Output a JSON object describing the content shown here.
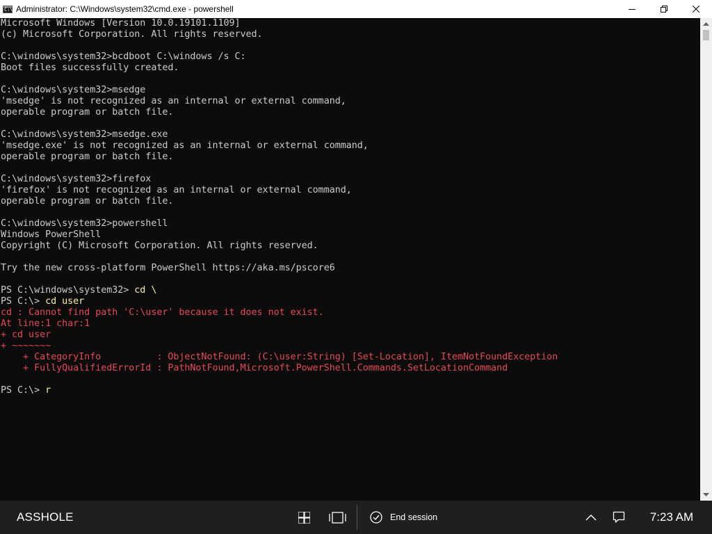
{
  "window": {
    "title": "Administrator: C:\\Windows\\system32\\cmd.exe - powershell",
    "icon": "cmd-icon",
    "icon_glyph": "C:\\",
    "controls": [
      "minimize-icon",
      "restore-icon",
      "close-icon"
    ]
  },
  "console": {
    "background": "#0c0c0c",
    "colors": {
      "default": "#cccccc",
      "error": "#e74856",
      "input": "#f9f1a5"
    },
    "lines": [
      [
        {
          "t": "Microsoft Windows [Version 10.0.19101.1109]",
          "c": "gray"
        }
      ],
      [
        {
          "t": "(c) Microsoft Corporation. All rights reserved.",
          "c": "gray"
        }
      ],
      [
        {
          "t": "",
          "c": "gray"
        }
      ],
      [
        {
          "t": "C:\\windows\\system32>bcdboot C:\\windows /s C:",
          "c": "gray"
        }
      ],
      [
        {
          "t": "Boot files successfully created.",
          "c": "gray"
        }
      ],
      [
        {
          "t": "",
          "c": "gray"
        }
      ],
      [
        {
          "t": "C:\\windows\\system32>msedge",
          "c": "gray"
        }
      ],
      [
        {
          "t": "'msedge' is not recognized as an internal or external command,",
          "c": "gray"
        }
      ],
      [
        {
          "t": "operable program or batch file.",
          "c": "gray"
        }
      ],
      [
        {
          "t": "",
          "c": "gray"
        }
      ],
      [
        {
          "t": "C:\\windows\\system32>msedge.exe",
          "c": "gray"
        }
      ],
      [
        {
          "t": "'msedge.exe' is not recognized as an internal or external command,",
          "c": "gray"
        }
      ],
      [
        {
          "t": "operable program or batch file.",
          "c": "gray"
        }
      ],
      [
        {
          "t": "",
          "c": "gray"
        }
      ],
      [
        {
          "t": "C:\\windows\\system32>firefox",
          "c": "gray"
        }
      ],
      [
        {
          "t": "'firefox' is not recognized as an internal or external command,",
          "c": "gray"
        }
      ],
      [
        {
          "t": "operable program or batch file.",
          "c": "gray"
        }
      ],
      [
        {
          "t": "",
          "c": "gray"
        }
      ],
      [
        {
          "t": "C:\\windows\\system32>powershell",
          "c": "gray"
        }
      ],
      [
        {
          "t": "Windows PowerShell",
          "c": "gray"
        }
      ],
      [
        {
          "t": "Copyright (C) Microsoft Corporation. All rights reserved.",
          "c": "gray"
        }
      ],
      [
        {
          "t": "",
          "c": "gray"
        }
      ],
      [
        {
          "t": "Try the new cross-platform PowerShell https://aka.ms/pscore6",
          "c": "gray"
        }
      ],
      [
        {
          "t": "",
          "c": "gray"
        }
      ],
      [
        {
          "t": "PS C:\\windows\\system32> ",
          "c": "gray"
        },
        {
          "t": "cd \\",
          "c": "yellow"
        }
      ],
      [
        {
          "t": "PS C:\\> ",
          "c": "gray"
        },
        {
          "t": "cd user",
          "c": "yellow"
        }
      ],
      [
        {
          "t": "cd : Cannot find path 'C:\\user' because it does not exist.",
          "c": "red"
        }
      ],
      [
        {
          "t": "At line:1 char:1",
          "c": "red"
        }
      ],
      [
        {
          "t": "+ cd user",
          "c": "red"
        }
      ],
      [
        {
          "t": "+ ~~~~~~~",
          "c": "red"
        }
      ],
      [
        {
          "t": "    + CategoryInfo          : ObjectNotFound: (C:\\user:String) [Set-Location], ItemNotFoundException",
          "c": "red"
        }
      ],
      [
        {
          "t": "    + FullyQualifiedErrorId : PathNotFound,Microsoft.PowerShell.Commands.SetLocationCommand",
          "c": "red"
        }
      ],
      [
        {
          "t": "",
          "c": "gray"
        }
      ],
      [
        {
          "t": "PS C:\\> ",
          "c": "gray"
        },
        {
          "t": "r",
          "c": "yellow"
        }
      ]
    ]
  },
  "scrollbar": {
    "up_icon": "scroll-up-arrow-icon",
    "down_icon": "scroll-down-arrow-icon"
  },
  "taskbar": {
    "background": "#1f1f1f",
    "user_label": "ASSHOLE",
    "start_icon": "windows-logo-icon",
    "task_view_icon": "task-view-icon",
    "end_session_icon": "check-circle-icon",
    "end_session_label": "End session",
    "tray_icons": [
      "chevron-up-icon",
      "notification-icon"
    ],
    "clock": "7:23 AM"
  }
}
